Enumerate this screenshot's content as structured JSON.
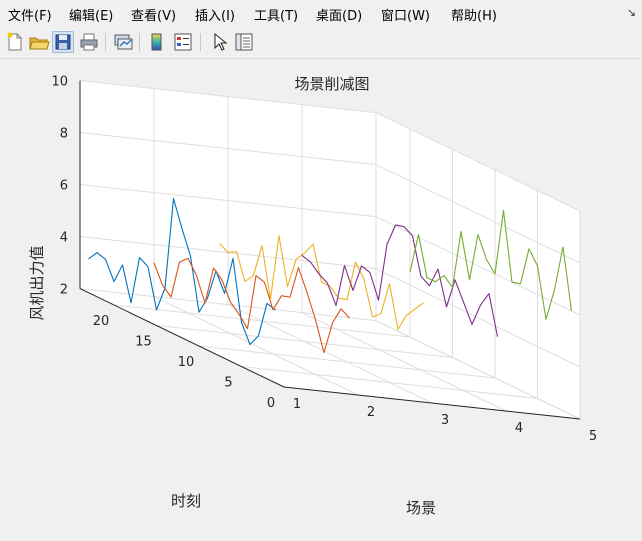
{
  "menu": [
    "文件(F)",
    "编辑(E)",
    "查看(V)",
    "插入(I)",
    "工具(T)",
    "桌面(D)",
    "窗口(W)",
    "帮助(H)"
  ],
  "dock_glyph": "↘",
  "toolbar": {
    "buttons": [
      "new-figure-icon",
      "open-file-icon",
      "save-icon",
      "print-icon",
      "link-plot-icon",
      "insert-colorbar-icon",
      "insert-legend-icon",
      "edit-plot-arrow-icon",
      "property-inspector-icon"
    ],
    "active": "save-icon"
  },
  "chart_data": {
    "type": "line3d",
    "title": "场景削减图",
    "xlabel": "场景",
    "ylabel": "时刻",
    "zlabel": "风机出力值",
    "xlim": [
      1,
      5
    ],
    "ylim": [
      0,
      24
    ],
    "zlim": [
      2,
      10
    ],
    "xticks": [
      "1",
      "2",
      "3",
      "4",
      "5"
    ],
    "yticks": [
      "0",
      "5",
      "10",
      "15",
      "20"
    ],
    "zticks": [
      "2",
      "4",
      "6",
      "8",
      "10"
    ],
    "grid": true,
    "series": [
      {
        "x": 1,
        "color": "#0072BD",
        "values": [
          4.8,
          4.9,
          3.5,
          3.0,
          3.7,
          6.0,
          4.5,
          5.2,
          4.0,
          3.3,
          5.3,
          6.2,
          7.2,
          3.6,
          2.6,
          4.1,
          4.3,
          2.4,
          3.7,
          2.9,
          3.6,
          3.7,
          3.3
        ]
      },
      {
        "x": 2,
        "color": "#D95319",
        "values": [
          4.8,
          5.0,
          4.3,
          3.0,
          4.1,
          5.0,
          5.8,
          4.5,
          4.4,
          3.7,
          4.6,
          4.7,
          2.5,
          2.9,
          3.2,
          3.9,
          4.2,
          2.7,
          3.6,
          4.1,
          3.8,
          2.3,
          2.6,
          3.3
        ]
      },
      {
        "x": 3,
        "color": "#EDB120",
        "values": [
          5.7,
          5.3,
          4.9,
          4.2,
          5.8,
          4.5,
          4.2,
          5.5,
          6.0,
          4.4,
          4.3,
          4.6,
          4.6,
          5.9,
          5.4,
          5.0,
          3.8,
          5.6,
          3.0,
          4.9,
          3.6,
          3.2,
          4.2,
          4.0,
          4.2
        ]
      },
      {
        "x": 4,
        "color": "#7E2F8E",
        "values": [
          4.7,
          6.2,
          5.6,
          4.7,
          5.4,
          6.1,
          4.9,
          6.2,
          5.4,
          5.6,
          7.0,
          7.2,
          7.1,
          6.2,
          3.9,
          4.8,
          4.9,
          3.8,
          4.6,
          2.9,
          3.6,
          3.8,
          4.1,
          4.2
        ]
      },
      {
        "x": 5,
        "color": "#77AC30",
        "values": [
          6.0,
          8.3,
          6.5,
          5.2,
          7.1,
          7.6,
          6.1,
          6.0,
          8.6,
          6.0,
          6.4,
          7.2,
          5.3,
          7.0,
          4.7,
          5.0,
          4.6,
          4.6,
          6.1,
          4.5
        ]
      }
    ]
  }
}
